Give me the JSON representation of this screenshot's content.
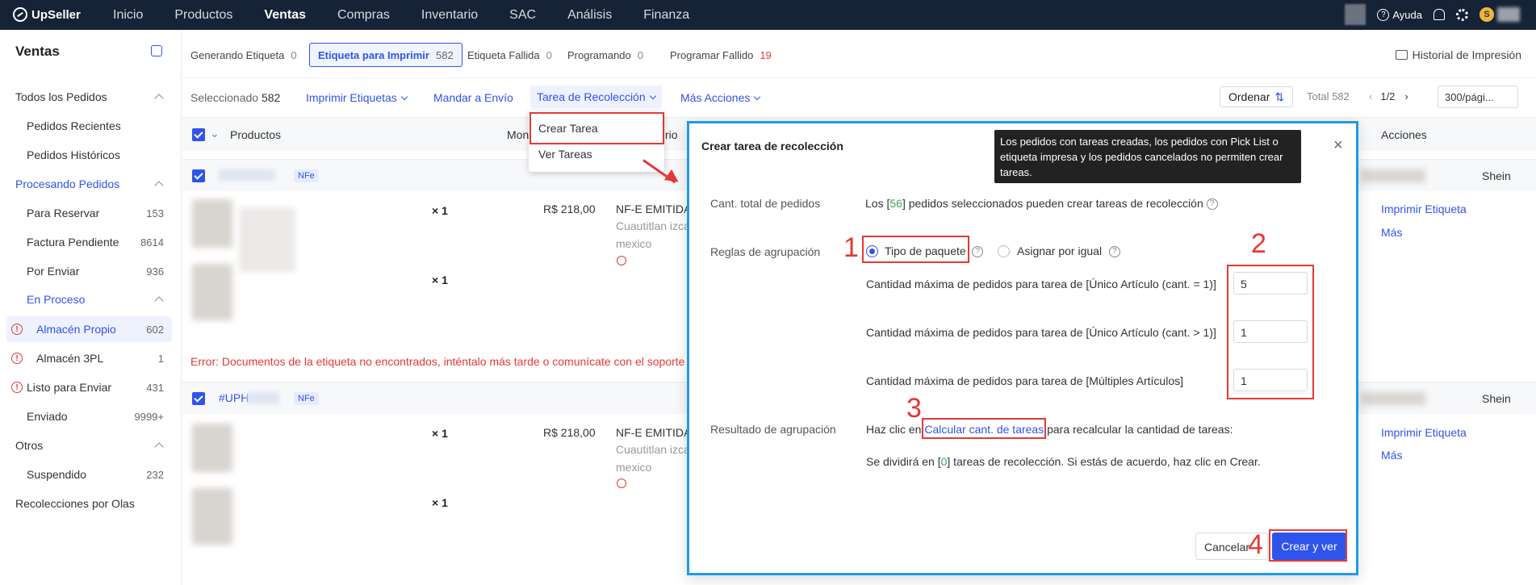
{
  "app": {
    "name": "UpSeller"
  },
  "nav": {
    "items": [
      "Inicio",
      "Productos",
      "Ventas",
      "Compras",
      "Inventario",
      "SAC",
      "Análisis",
      "Finanza"
    ],
    "active": "Ventas"
  },
  "topbar": {
    "help": "Ayuda",
    "badge": "S"
  },
  "sidebar": {
    "title": "Ventas",
    "items": [
      {
        "label": "Todos los Pedidos",
        "group": true
      },
      {
        "label": "Pedidos Recientes"
      },
      {
        "label": "Pedidos Históricos"
      },
      {
        "label": "Procesando Pedidos",
        "group": true
      },
      {
        "label": "Para Reservar",
        "count": "153"
      },
      {
        "label": "Factura Pendiente",
        "count": "8614"
      },
      {
        "label": "Por Enviar",
        "count": "936"
      },
      {
        "label": "En Proceso",
        "group": true
      },
      {
        "label": "Almacén Propio",
        "count": "602"
      },
      {
        "label": "Almacén 3PL",
        "count": "1"
      },
      {
        "label": "Listo para Enviar",
        "count": "431"
      },
      {
        "label": "Enviado",
        "count": "9999+"
      },
      {
        "label": "Otros",
        "group": true
      },
      {
        "label": "Suspendido",
        "count": "232"
      },
      {
        "label": "Recolecciones por Olas"
      }
    ]
  },
  "tabs": [
    {
      "label": "Generando Etiqueta",
      "count": "0"
    },
    {
      "label": "Etiqueta para Imprimir",
      "count": "582"
    },
    {
      "label": "Etiqueta Fallida",
      "count": "0"
    },
    {
      "label": "Programando",
      "count": "0"
    },
    {
      "label": "Programar Fallido",
      "count": "19"
    }
  ],
  "history": "Historial de Impresión",
  "toolbar": {
    "selected_label": "Seleccionado",
    "selected_count": "582",
    "print": "Imprimir Etiquetas",
    "send": "Mandar a Envío",
    "pick": "Tarea de Recolección",
    "more": "Más Acciones",
    "order": "Ordenar",
    "total": "Total 582",
    "page": "1/2",
    "per_page": "300/pági..."
  },
  "dropdown": {
    "create": "Crear Tarea",
    "view": "Ver Tareas"
  },
  "table": {
    "col_products": "Productos",
    "col_mon": "Mon",
    "col_rio": "rio",
    "col_actions": "Acciones",
    "qty": "× 1",
    "price": "R$ 218,00",
    "nfe_badge": "NFe",
    "emit": "NF-E EMITIDA",
    "city": "Cuautitlan izca",
    "country": "mexico",
    "print_label": "Imprimir Etiqueta",
    "more": "Más",
    "store": "Shein",
    "order2": "#UPH",
    "error": "Error: Documentos de la etiqueta no encontrados, inténtalo más tarde o comunícate con el soporte"
  },
  "modal": {
    "title": "Crear tarea de recolección",
    "tooltip": "Los pedidos con tareas creadas, los pedidos con Pick List o etiqueta impresa y los pedidos cancelados no permiten crear tareas.",
    "total_label": "Cant. total de pedidos",
    "total_pre": "Los [",
    "total_num": "56",
    "total_post": "] pedidos seleccionados pueden crear tareas de recolección",
    "rules_label": "Reglas de agrupación",
    "opt1": "Tipo de paquete",
    "opt2": "Asignar por igual",
    "max1": "Cantidad máxima de pedidos para tarea de [Único Artículo (cant. = 1)]",
    "max2": "Cantidad máxima de pedidos para tarea de [Único Artículo (cant. > 1)]",
    "max3": "Cantidad máxima de pedidos para tarea de [Múltiples Artículos]",
    "val1": "5",
    "val2": "1",
    "val3": "1",
    "result_label": "Resultado de agrupación",
    "result_pre": "Haz clic en ",
    "result_link": "Calcular cant. de tareas",
    "result_post": " para recalcular la cantidad de tareas:",
    "divide_pre": "Se dividirá en [",
    "divide_num": "0",
    "divide_post": "] tareas de recolección. Si estás de acuerdo, haz clic en Crear.",
    "cancel": "Cancelar",
    "create": "Crear y ver"
  },
  "annotations": {
    "n1": "1",
    "n2": "2",
    "n3": "3",
    "n4": "4"
  },
  "colors": {
    "primary": "#2f54eb",
    "annotation": "#e53935",
    "modal_border": "#1e9be8",
    "topbar": "#162236"
  }
}
